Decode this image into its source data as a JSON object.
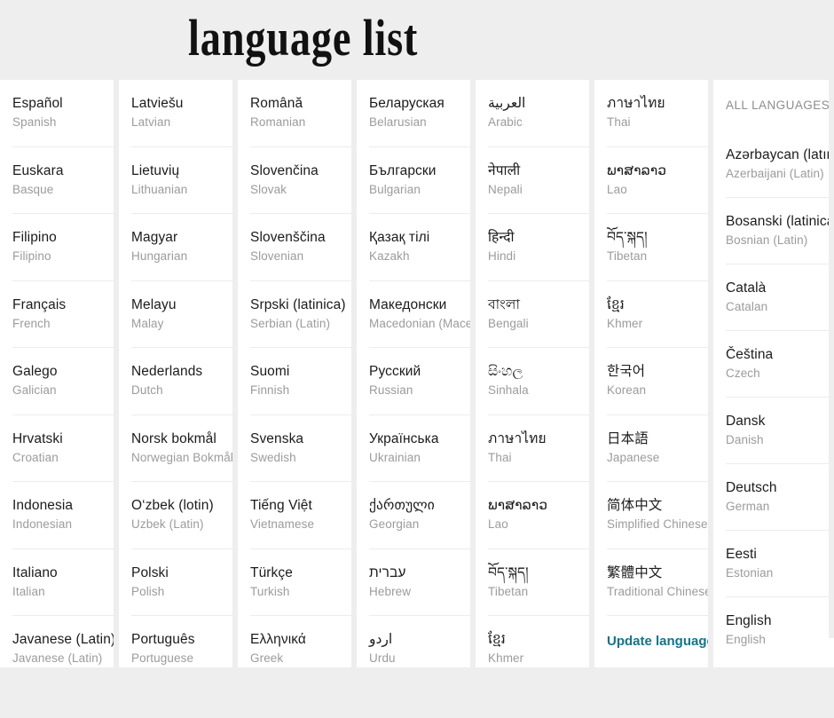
{
  "header": {
    "title": "language  list"
  },
  "columns": [
    {
      "id": "col-1",
      "entries": [
        {
          "native": "Español",
          "english": "Spanish"
        },
        {
          "native": "Euskara",
          "english": "Basque"
        },
        {
          "native": "Filipino",
          "english": "Filipino"
        },
        {
          "native": "Français",
          "english": "French"
        },
        {
          "native": "Galego",
          "english": "Galician"
        },
        {
          "native": "Hrvatski",
          "english": "Croatian"
        },
        {
          "native": "Indonesia",
          "english": "Indonesian"
        },
        {
          "native": "Italiano",
          "english": "Italian"
        },
        {
          "native": "Javanese (Latin)",
          "english": "Javanese (Latin)"
        }
      ]
    },
    {
      "id": "col-2",
      "entries": [
        {
          "native": "Latviešu",
          "english": "Latvian"
        },
        {
          "native": "Lietuvių",
          "english": "Lithuanian"
        },
        {
          "native": "Magyar",
          "english": "Hungarian"
        },
        {
          "native": "Melayu",
          "english": "Malay"
        },
        {
          "native": "Nederlands",
          "english": "Dutch"
        },
        {
          "native": "Norsk bokmål",
          "english": "Norwegian Bokmål"
        },
        {
          "native": "O‘zbek (lotin)",
          "english": "Uzbek (Latin)"
        },
        {
          "native": "Polski",
          "english": "Polish"
        },
        {
          "native": "Português",
          "english": "Portuguese"
        }
      ]
    },
    {
      "id": "col-3",
      "entries": [
        {
          "native": "Română",
          "english": "Romanian"
        },
        {
          "native": "Slovenčina",
          "english": "Slovak"
        },
        {
          "native": "Slovenščina",
          "english": "Slovenian"
        },
        {
          "native": "Srpski (latinica)",
          "english": "Serbian (Latin)"
        },
        {
          "native": "Suomi",
          "english": "Finnish"
        },
        {
          "native": "Svenska",
          "english": "Swedish"
        },
        {
          "native": "Tiếng Việt",
          "english": "Vietnamese"
        },
        {
          "native": "Türkçe",
          "english": "Turkish"
        },
        {
          "native": "Ελληνικά",
          "english": "Greek"
        }
      ]
    },
    {
      "id": "col-4",
      "entries": [
        {
          "native": "Беларуская",
          "english": "Belarusian"
        },
        {
          "native": "Български",
          "english": "Bulgarian"
        },
        {
          "native": "Қазақ тілі",
          "english": "Kazakh"
        },
        {
          "native": "Македонски",
          "english": "Macedonian (Macedonia)"
        },
        {
          "native": "Русский",
          "english": "Russian"
        },
        {
          "native": "Українська",
          "english": "Ukrainian"
        },
        {
          "native": "ქართული",
          "english": "Georgian"
        },
        {
          "native": "עברית",
          "english": "Hebrew"
        },
        {
          "native": "اردو",
          "english": "Urdu"
        }
      ]
    },
    {
      "id": "col-5",
      "entries": [
        {
          "native": "العربية",
          "english": "Arabic"
        },
        {
          "native": "नेपाली",
          "english": "Nepali"
        },
        {
          "native": "हिन्दी",
          "english": "Hindi"
        },
        {
          "native": "বাংলা",
          "english": "Bengali"
        },
        {
          "native": "සිංහල",
          "english": "Sinhala"
        },
        {
          "native": "ภาษาไทย",
          "english": "Thai"
        },
        {
          "native": "ພາສາລາວ",
          "english": "Lao"
        },
        {
          "native": "བོད་སྐད།",
          "english": "Tibetan"
        },
        {
          "native": "ខ្មែរ",
          "english": "Khmer"
        }
      ]
    },
    {
      "id": "col-6",
      "entries": [
        {
          "native": "ภาษาไทย",
          "english": "Thai"
        },
        {
          "native": "ພາສາລາວ",
          "english": "Lao"
        },
        {
          "native": "བོད་སྐད།",
          "english": "Tibetan"
        },
        {
          "native": "ខ្មែរ",
          "english": "Khmer"
        },
        {
          "native": "한국어",
          "english": "Korean"
        },
        {
          "native": "日本語",
          "english": "Japanese"
        },
        {
          "native": "简体中文",
          "english": "Simplified Chinese"
        },
        {
          "native": "繁體中文",
          "english": "Traditional Chinese"
        }
      ],
      "link_label": "Update languages"
    },
    {
      "id": "col-7",
      "caption": "ALL LANGUAGES",
      "entries": [
        {
          "native": "Azərbaycan (latın)",
          "english": "Azerbaijani (Latin)"
        },
        {
          "native": "Bosanski (latinica)",
          "english": "Bosnian (Latin)"
        },
        {
          "native": "Català",
          "english": "Catalan"
        },
        {
          "native": "Čeština",
          "english": "Czech"
        },
        {
          "native": "Dansk",
          "english": "Danish"
        },
        {
          "native": "Deutsch",
          "english": "German"
        },
        {
          "native": "Eesti",
          "english": "Estonian"
        },
        {
          "native": "English",
          "english": "English"
        }
      ]
    }
  ],
  "colors": {
    "page_background": "#eeeeee",
    "card_background": "#ffffff",
    "native_text": "#1b1b1b",
    "english_text": "#9b9b9b",
    "caption_text": "#8d8d8d",
    "divider": "#ececec",
    "link_accent": "#14738a"
  }
}
